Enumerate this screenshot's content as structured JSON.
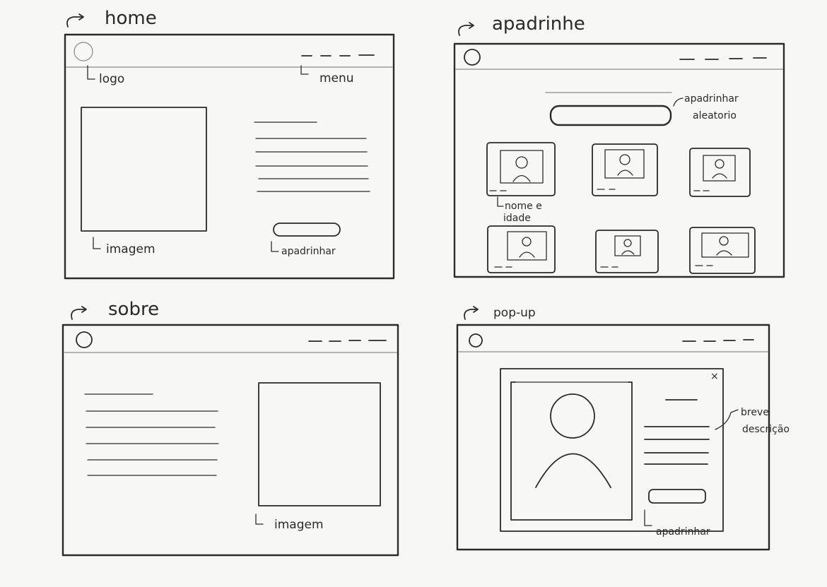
{
  "frames": {
    "home": {
      "title": "home",
      "annotations": {
        "logo": "logo",
        "menu": "menu",
        "image": "imagem",
        "cta": "apadrinhar"
      }
    },
    "apadrinhe": {
      "title": "apadrinhe",
      "annotations": {
        "random_line1": "apadrinhar",
        "random_line2": "aleatorio",
        "card_line1": "nome e",
        "card_line2": "idade"
      },
      "card_count": 6
    },
    "sobre": {
      "title": "sobre",
      "annotations": {
        "image": "imagem"
      }
    },
    "popup": {
      "title": "pop-up",
      "close_glyph": "×",
      "annotations": {
        "desc_line1": "breve",
        "desc_line2": "descrição",
        "cta": "apadrinhar"
      }
    }
  },
  "colors": {
    "ink": "#2a2a2a",
    "paper": "#f7f7f6",
    "faint": "#8a8a8a"
  },
  "arrow_glyph": "↳"
}
